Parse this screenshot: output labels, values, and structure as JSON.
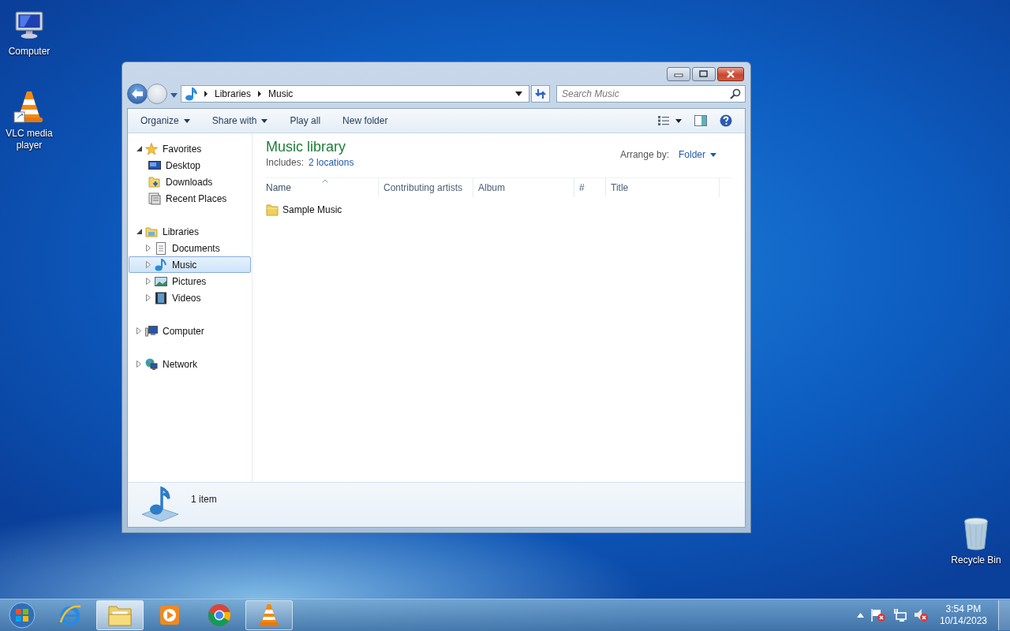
{
  "desktop_icons": [
    {
      "label": "Computer",
      "kind": "computer"
    },
    {
      "label": "VLC media player",
      "kind": "vlc"
    },
    {
      "label": "Recycle Bin",
      "kind": "recycle"
    }
  ],
  "back_button": {
    "disabled": false
  },
  "forward_button": {
    "disabled": true
  },
  "address_bar": {
    "segments": [
      "Libraries",
      "Music"
    ]
  },
  "search": {
    "placeholder": "Search Music"
  },
  "toolbar": [
    {
      "label": "Organize",
      "dropdown": true
    },
    {
      "label": "Share with",
      "dropdown": true
    },
    {
      "label": "Play all",
      "dropdown": false
    },
    {
      "label": "New folder",
      "dropdown": false
    }
  ],
  "navigation": [
    {
      "label": "Favorites",
      "kind": "star",
      "expanded": true,
      "selected": false,
      "children": [
        {
          "label": "Desktop",
          "kind": "desktop",
          "selected": false
        },
        {
          "label": "Downloads",
          "kind": "downloads",
          "selected": false
        },
        {
          "label": "Recent Places",
          "kind": "recent",
          "selected": false
        }
      ]
    },
    {
      "label": "Libraries",
      "kind": "libraries",
      "expanded": true,
      "selected": false,
      "children": [
        {
          "label": "Documents",
          "kind": "documents",
          "expanded": false,
          "selected": false
        },
        {
          "label": "Music",
          "kind": "music",
          "expanded": false,
          "selected": true
        },
        {
          "label": "Pictures",
          "kind": "pictures",
          "expanded": false,
          "selected": false
        },
        {
          "label": "Videos",
          "kind": "videos",
          "expanded": false,
          "selected": false
        }
      ]
    },
    {
      "label": "Computer",
      "kind": "computer",
      "expanded": false,
      "selected": false
    },
    {
      "label": "Network",
      "kind": "network",
      "expanded": false,
      "selected": false
    }
  ],
  "library": {
    "title": "Music library",
    "includes_label": "Includes:",
    "includes_link": "2 locations",
    "arrange_label": "Arrange by:",
    "arrange_value": "Folder"
  },
  "columns": [
    {
      "label": "Name",
      "sorted": true
    },
    {
      "label": "Contributing artists",
      "sorted": false
    },
    {
      "label": "Album",
      "sorted": false
    },
    {
      "label": "#",
      "sorted": false
    },
    {
      "label": "Title",
      "sorted": false
    }
  ],
  "items": [
    {
      "name": "Sample Music"
    }
  ],
  "details": {
    "text": "1 item"
  },
  "taskbar": {
    "apps": [
      {
        "kind": "ie",
        "running": false,
        "active": false
      },
      {
        "kind": "explorer",
        "running": true,
        "active": true
      },
      {
        "kind": "mediaplayer",
        "running": false,
        "active": false
      },
      {
        "kind": "chrome",
        "running": false,
        "active": false
      },
      {
        "kind": "vlc",
        "running": true,
        "active": false
      }
    ],
    "time": "3:54 PM",
    "date": "10/14/2023"
  }
}
